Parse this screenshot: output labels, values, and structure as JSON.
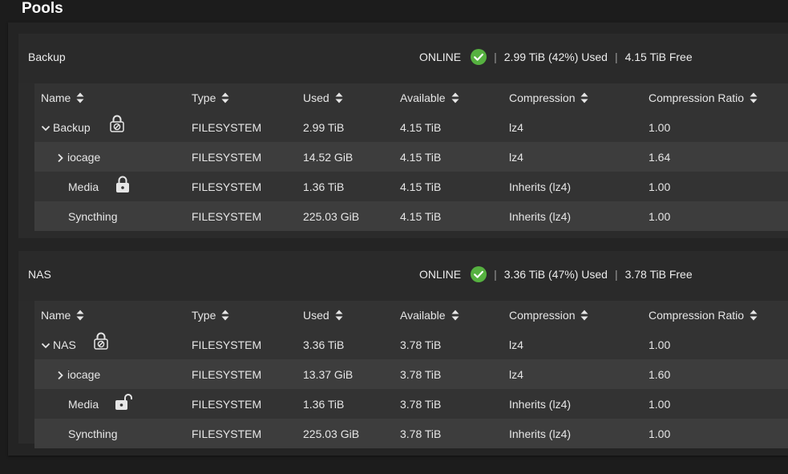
{
  "page": {
    "title": "Pools"
  },
  "columns": [
    "Name",
    "Type",
    "Used",
    "Available",
    "Compression",
    "Compression Ratio"
  ],
  "pools": [
    {
      "name": "Backup",
      "status": "ONLINE",
      "usage": "2.99 TiB (42%) Used",
      "free": "4.15 TiB Free",
      "rows": [
        {
          "name": "Backup",
          "type": "FILESYSTEM",
          "used": "2.99 TiB",
          "available": "4.15 TiB",
          "compression": "lz4",
          "ratio": "1.00",
          "expander": "expanded",
          "lock": "lock-disabled-icon"
        },
        {
          "name": "iocage",
          "type": "FILESYSTEM",
          "used": "14.52 GiB",
          "available": "4.15 TiB",
          "compression": "lz4",
          "ratio": "1.64",
          "expander": "collapsed",
          "lock": ""
        },
        {
          "name": "Media",
          "type": "FILESYSTEM",
          "used": "1.36 TiB",
          "available": "4.15 TiB",
          "compression": "Inherits (lz4)",
          "ratio": "1.00",
          "expander": "",
          "lock": "lock-closed-icon"
        },
        {
          "name": "Syncthing",
          "type": "FILESYSTEM",
          "used": "225.03 GiB",
          "available": "4.15 TiB",
          "compression": "Inherits (lz4)",
          "ratio": "1.00",
          "expander": "",
          "lock": ""
        }
      ]
    },
    {
      "name": "NAS",
      "status": "ONLINE",
      "usage": "3.36 TiB (47%) Used",
      "free": "3.78 TiB Free",
      "rows": [
        {
          "name": "NAS",
          "type": "FILESYSTEM",
          "used": "3.36 TiB",
          "available": "3.78 TiB",
          "compression": "lz4",
          "ratio": "1.00",
          "expander": "expanded",
          "lock": "lock-disabled-icon"
        },
        {
          "name": "iocage",
          "type": "FILESYSTEM",
          "used": "13.37 GiB",
          "available": "3.78 TiB",
          "compression": "lz4",
          "ratio": "1.60",
          "expander": "collapsed",
          "lock": ""
        },
        {
          "name": "Media",
          "type": "FILESYSTEM",
          "used": "1.36 TiB",
          "available": "3.78 TiB",
          "compression": "Inherits (lz4)",
          "ratio": "1.00",
          "expander": "",
          "lock": "lock-open-icon"
        },
        {
          "name": "Syncthing",
          "type": "FILESYSTEM",
          "used": "225.03 GiB",
          "available": "3.78 TiB",
          "compression": "Inherits (lz4)",
          "ratio": "1.00",
          "expander": "",
          "lock": ""
        }
      ]
    }
  ],
  "colors": {
    "online_check": "#56b140",
    "page_bg": "#1c1c1c",
    "row_alt": "#3d3d3d"
  }
}
